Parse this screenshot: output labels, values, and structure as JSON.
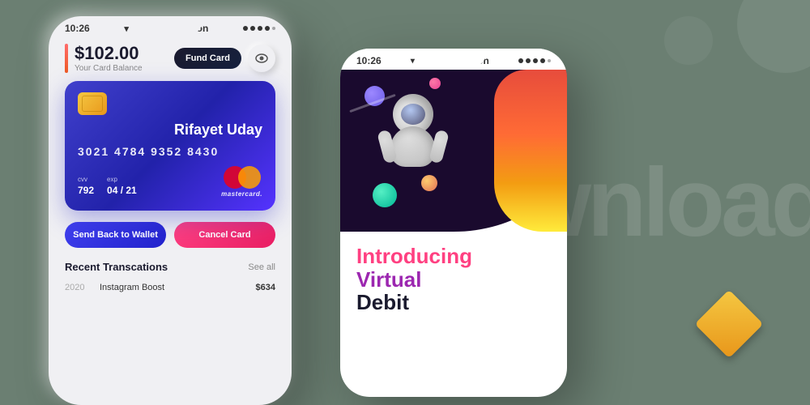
{
  "background_color": "#6b7f72",
  "bg_text": "wnload",
  "phone_left": {
    "status_bar": {
      "time": "10:26",
      "signal_icon": "▾",
      "app_name": "Telemoon",
      "dots": [
        "●",
        "●",
        "●",
        "●",
        "○"
      ]
    },
    "balance": {
      "amount": "$102.00",
      "label": "Your Card Balance"
    },
    "fund_btn_label": "Fund Card",
    "eye_icon": "👁",
    "card": {
      "name": "Rifayet Uday",
      "number": "3021  4784  9352  8430",
      "cvv_label": "cvv",
      "cvv_value": "792",
      "exp_label": "exp",
      "exp_value": "04 / 21",
      "mastercard_label": "mastercard."
    },
    "wallet_btn": "Send Back to Wallet",
    "cancel_btn": "Cancel Card",
    "transactions": {
      "title": "Recent Transcations",
      "see_all": "See all",
      "items": [
        {
          "year": "2020",
          "name": "Instagram Boost",
          "amount": "$634"
        }
      ]
    }
  },
  "phone_right": {
    "status_bar": {
      "time": "10:26",
      "signal_icon": "▾",
      "app_name": "Telemoon",
      "dots": [
        "●",
        "●",
        "●",
        "●",
        "○"
      ]
    },
    "intro_text": {
      "line1": "Introducing",
      "line2": "Virtual",
      "line3": "Debit"
    }
  },
  "icons": {
    "diamond": "◆",
    "eye": "○"
  }
}
